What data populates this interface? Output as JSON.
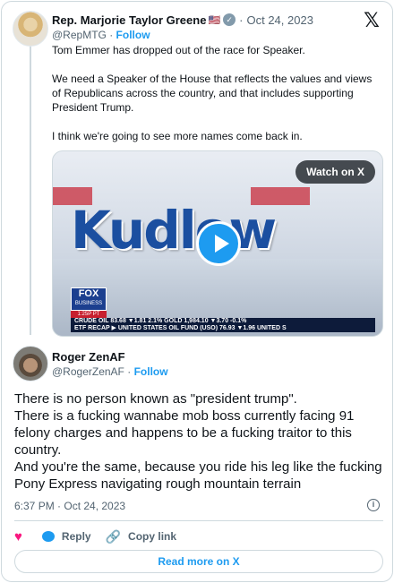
{
  "quoted_tweet": {
    "author_name": "Rep. Marjorie Taylor Greene",
    "flag": "🇺🇸",
    "date": "Oct 24, 2023",
    "handle": "@RepMTG",
    "follow_label": "Follow",
    "paragraphs": [
      "Tom Emmer has dropped out of the race for Speaker.",
      "We need a Speaker of the House that reflects the values and views of Republicans across the country, and that includes supporting President Trump.",
      "I think we're going to see more names come back in."
    ],
    "media": {
      "watch_label": "Watch on X",
      "show_title": "Kudlow",
      "fox_logo_top": "FOX",
      "fox_logo_bottom": "BUSINESS",
      "time_badge": "1:25P PT",
      "ticker_line1": "CRUDE OIL      83.68  ▼1.81  2.1%  GOLD        1,984.10  ▼3.70  -0.1%",
      "ticker_line2": "ETF RECAP  ▶ UNITED STATES OIL FUND (USO)  76.93  ▼1.96   UNITED S"
    }
  },
  "main_tweet": {
    "author_name": "Roger ZenAF",
    "handle": "@RogerZenAF",
    "follow_label": "Follow",
    "text_lines": [
      "There is no person known as \"president trump\".",
      "There is a fucking wannabe mob boss currently facing 91 felony charges and happens to be a fucking traitor to this country.",
      "And you're the same, because you ride his leg like the fucking Pony Express navigating rough mountain terrain"
    ],
    "timestamp": "6:37 PM · Oct 24, 2023"
  },
  "actions": {
    "reply_label": "Reply",
    "copy_link_label": "Copy link"
  },
  "read_more_label": "Read more on X",
  "colors": {
    "accent": "#1d9bf0",
    "like": "#f91880",
    "muted": "#536471",
    "border": "#cfd9de"
  },
  "icons": [
    "x-logo-icon",
    "verified-badge-icon",
    "play-icon",
    "info-icon",
    "heart-icon",
    "reply-icon",
    "link-icon"
  ]
}
